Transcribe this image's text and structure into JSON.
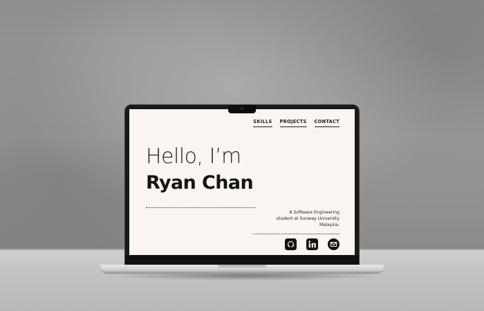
{
  "nav": {
    "items": [
      {
        "label": "SKILLS"
      },
      {
        "label": "PROJECTS"
      },
      {
        "label": "CONTACT"
      }
    ]
  },
  "hero": {
    "greeting": "Hello, I’m",
    "name": "Ryan Chan",
    "intro_lines": [
      "A Software Engineering",
      "student at Sunway University",
      "Malaysia."
    ]
  },
  "socials": [
    {
      "icon": "github-icon"
    },
    {
      "icon": "linkedin-icon"
    },
    {
      "icon": "mail-icon"
    }
  ],
  "colors": {
    "screen_background": "#faf5f0",
    "text": "#1d1d1d",
    "icon_fill": "#111111"
  }
}
